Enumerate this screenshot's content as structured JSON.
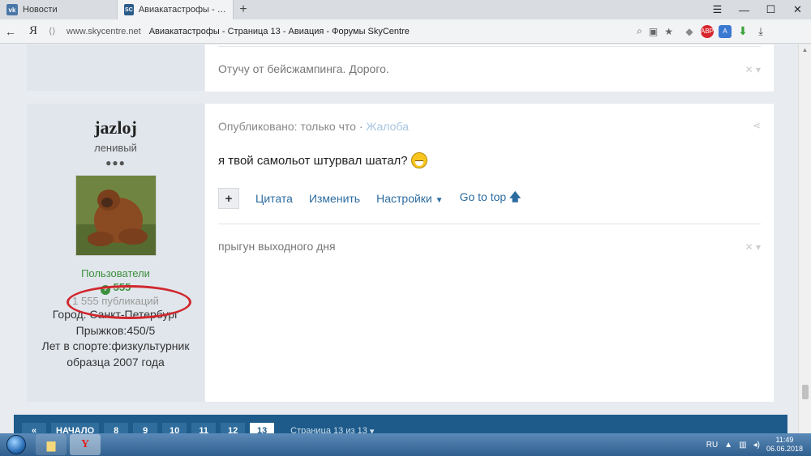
{
  "browser": {
    "tabs": [
      {
        "label": "Новости",
        "icon": "vk-icon",
        "active": false
      },
      {
        "label": "Авиакатастрофы - Стран",
        "icon": "skycentre-icon",
        "active": true
      }
    ],
    "back_icon": "←",
    "yandex_logo": "Я",
    "address": {
      "domain": "www.skycentre.net",
      "page_title": "Авиакатастрофы - Страница 13 - Авиация - Форумы SkyCentre"
    },
    "extensions": [
      "ABP"
    ]
  },
  "previous_post": {
    "signature": "Отучу от бейсжампинга. Дорого."
  },
  "author": {
    "name": "jazloj",
    "rank": "ленивый",
    "rank_dots": "●●●",
    "group": "Пользователи",
    "reputation": "555",
    "posts_count": "1 555 публикаций",
    "info_lines": [
      "Город: Санкт-Петербург",
      "Прыжков:450/5",
      "Лет в спорте:физкультурник",
      "образца 2007 года"
    ]
  },
  "post": {
    "published": "Опубликовано: только что",
    "separator": " · ",
    "report_link": "Жалоба",
    "text": "я твой самольот штурвал шатал?",
    "actions": {
      "plus": "+",
      "quote": "Цитата",
      "edit": "Изменить",
      "settings": "Настройки",
      "goto_top": "Go to top"
    },
    "signature": "прыгун выходного дня"
  },
  "pagination": {
    "prev": "«",
    "start": "НАЧАЛО",
    "pages": [
      "8",
      "9",
      "10",
      "11",
      "12",
      "13"
    ],
    "current": "13",
    "info": "Страница 13 из 13"
  },
  "taskbar": {
    "language": "RU",
    "time": "11:49",
    "date": "06.06.2018"
  },
  "colors": {
    "accent": "#1e5b8a",
    "link": "#2c6ca0",
    "group_green": "#3c8f3c",
    "annotation_circle": "#d0282e"
  }
}
